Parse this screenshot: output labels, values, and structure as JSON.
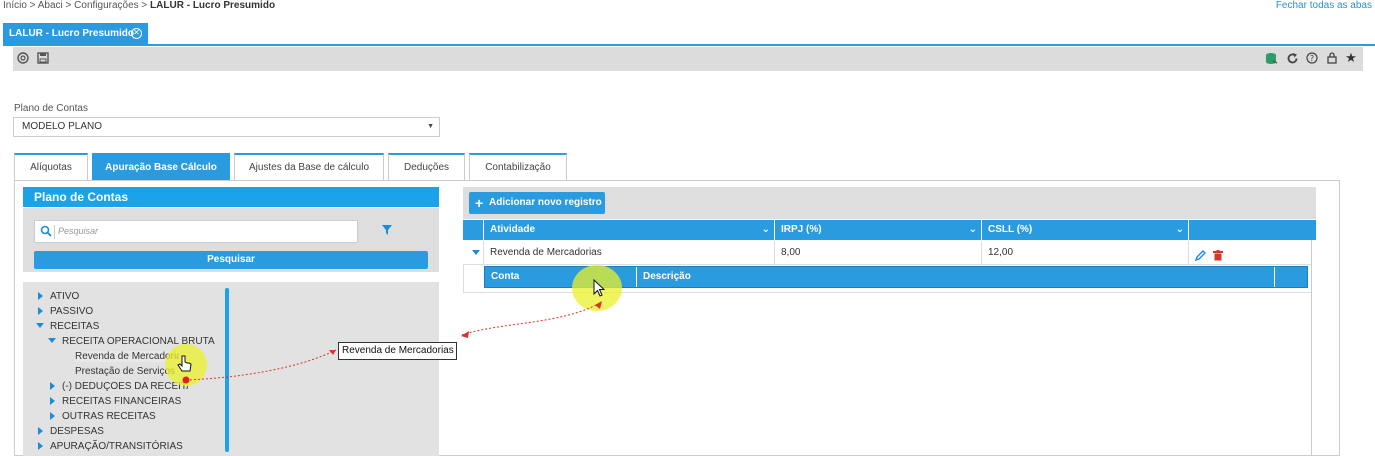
{
  "breadcrumb": {
    "path": "Início > Abaci > Configurações > ",
    "current": "LALUR - Lucro Presumido"
  },
  "close_all": "Fechar todas as abas",
  "main_tab": {
    "label": "LALUR - Lucro Presumido"
  },
  "toolbar": {
    "left_icons": [
      "settings-icon",
      "save-icon"
    ],
    "right_icons": [
      "database-icon",
      "refresh-icon",
      "help-icon",
      "lock-icon",
      "star-icon"
    ]
  },
  "plano": {
    "label": "Plano de Contas",
    "selected": "MODELO PLANO"
  },
  "tabs": [
    {
      "label": "Alíquotas"
    },
    {
      "label": "Apuração Base Cálculo"
    },
    {
      "label": "Ajustes da Base de cálculo"
    },
    {
      "label": "Deduções"
    },
    {
      "label": "Contabilização"
    }
  ],
  "left_panel": {
    "title": "Plano de Contas",
    "search_placeholder": "Pesquisar",
    "search_button": "Pesquisar",
    "tree": [
      {
        "label": "ATIVO"
      },
      {
        "label": "PASSIVO"
      },
      {
        "label": "RECEITAS"
      },
      {
        "label": "RECEITA OPERACIONAL BRUTA"
      },
      {
        "label": "Revenda de Mercadorias"
      },
      {
        "label": "Prestação de Serviços"
      },
      {
        "label": "(-) DEDUÇÕES DA RECEITA"
      },
      {
        "label": "RECEITAS FINANCEIRAS"
      },
      {
        "label": "OUTRAS RECEITAS"
      },
      {
        "label": "DESPESAS"
      },
      {
        "label": "APURAÇÃO/TRANSITÓRIAS"
      }
    ]
  },
  "right_panel": {
    "add_button": "Adicionar novo registro",
    "columns": [
      "Atividade",
      "IRPJ (%)",
      "CSLL (%)"
    ],
    "rows": [
      {
        "atividade": "Revenda de Mercadorias",
        "irpj": "8,00",
        "csll": "12,00"
      }
    ],
    "sub_columns": [
      "Conta",
      "Descrição"
    ]
  },
  "tooltip": "Revenda de Mercadorias",
  "colors": {
    "accent": "#2b9be0",
    "panel": "#dedede",
    "highlight": "#ebf028"
  }
}
